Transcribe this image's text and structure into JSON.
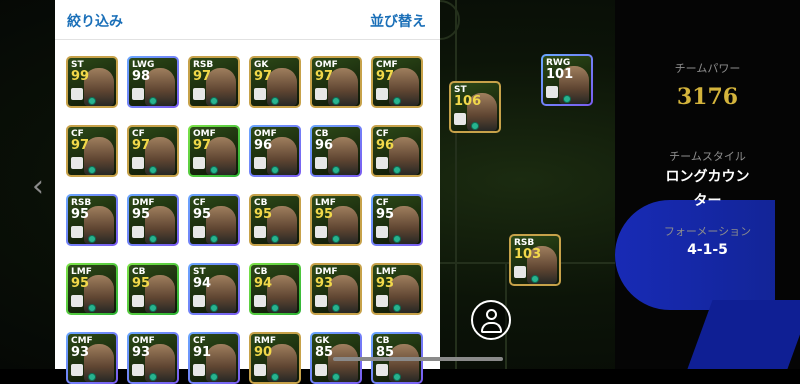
{
  "panel": {
    "filter_label": "絞り込み",
    "sort_label": "並び替え"
  },
  "players": [
    {
      "pos": "ST",
      "rating": "99",
      "frame": "gold"
    },
    {
      "pos": "LWG",
      "rating": "98",
      "frame": "blue"
    },
    {
      "pos": "RSB",
      "rating": "97",
      "frame": "gold"
    },
    {
      "pos": "GK",
      "rating": "97",
      "frame": "gold"
    },
    {
      "pos": "OMF",
      "rating": "97",
      "frame": "gold"
    },
    {
      "pos": "CMF",
      "rating": "97",
      "frame": "gold"
    },
    {
      "pos": "CF",
      "rating": "97",
      "frame": "gold"
    },
    {
      "pos": "CF",
      "rating": "97",
      "frame": "gold"
    },
    {
      "pos": "OMF",
      "rating": "97",
      "frame": "green"
    },
    {
      "pos": "OMF",
      "rating": "96",
      "frame": "blue"
    },
    {
      "pos": "CB",
      "rating": "96",
      "frame": "blue"
    },
    {
      "pos": "CF",
      "rating": "96",
      "frame": "gold"
    },
    {
      "pos": "RSB",
      "rating": "95",
      "frame": "blue"
    },
    {
      "pos": "DMF",
      "rating": "95",
      "frame": "blue"
    },
    {
      "pos": "CF",
      "rating": "95",
      "frame": "blue"
    },
    {
      "pos": "CB",
      "rating": "95",
      "frame": "gold"
    },
    {
      "pos": "LMF",
      "rating": "95",
      "frame": "gold"
    },
    {
      "pos": "CF",
      "rating": "95",
      "frame": "blue"
    },
    {
      "pos": "LMF",
      "rating": "95",
      "frame": "green"
    },
    {
      "pos": "CB",
      "rating": "95",
      "frame": "green"
    },
    {
      "pos": "ST",
      "rating": "94",
      "frame": "blue"
    },
    {
      "pos": "CB",
      "rating": "94",
      "frame": "green"
    },
    {
      "pos": "DMF",
      "rating": "93",
      "frame": "gold"
    },
    {
      "pos": "LMF",
      "rating": "93",
      "frame": "gold"
    },
    {
      "pos": "CMF",
      "rating": "93",
      "frame": "blue"
    },
    {
      "pos": "OMF",
      "rating": "93",
      "frame": "blue"
    },
    {
      "pos": "CF",
      "rating": "91",
      "frame": "blue"
    },
    {
      "pos": "RMF",
      "rating": "90",
      "frame": "gold"
    },
    {
      "pos": "GK",
      "rating": "85",
      "frame": "blue"
    },
    {
      "pos": "CB",
      "rating": "85",
      "frame": "blue"
    }
  ],
  "pitch_players": [
    {
      "pos": "RWG",
      "rating": "101",
      "frame": "blue"
    },
    {
      "pos": "ST",
      "rating": "106",
      "frame": "gold"
    },
    {
      "pos": "RSB",
      "rating": "103",
      "frame": "gold"
    }
  ],
  "team": {
    "power_label": "チームパワー",
    "power_value": "3176",
    "style_label": "チームスタイル",
    "style_value_line1": "ロングカウン",
    "style_value_line2": "ター",
    "formation_label": "フォーメーション",
    "formation_value": "4-1-5"
  },
  "colors": {
    "accent": "#1a6fb8",
    "power": "#d4b43c",
    "rating": "#f1d84a",
    "gold_frame": "#c7a24a"
  }
}
